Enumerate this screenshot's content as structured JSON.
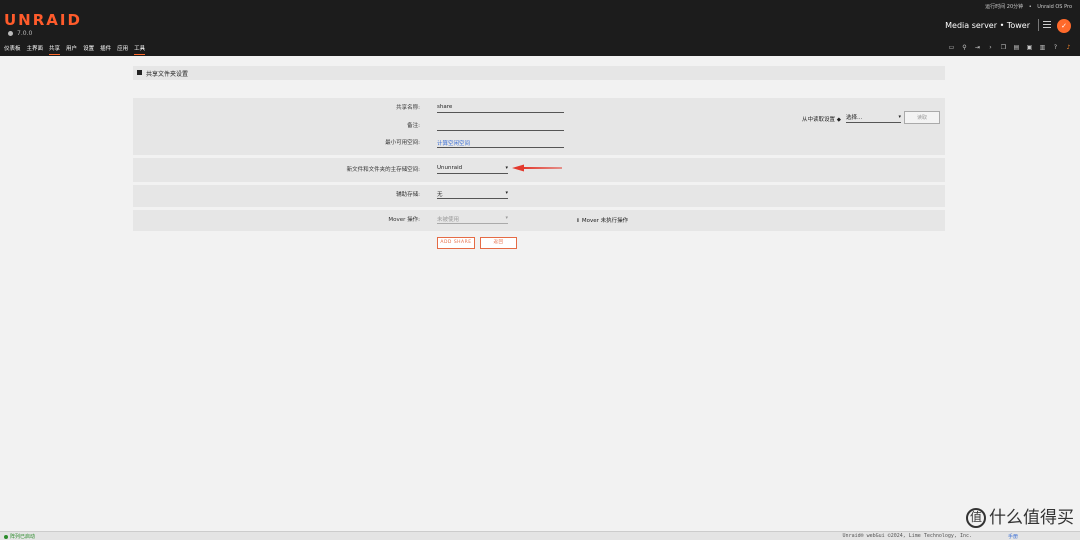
{
  "header": {
    "logo": "UNRAID",
    "version": "7.0.0",
    "uptime": "运行时间 20分钟",
    "separator": "•",
    "edition": "Unraid OS Pro",
    "server": "Media server • Tower"
  },
  "nav": {
    "items": [
      "仪表板",
      "主界面",
      "共享",
      "用户",
      "设置",
      "插件",
      "应用",
      "工具"
    ]
  },
  "panel": {
    "title": "共享文件夹设置"
  },
  "form": {
    "share_name_label": "共享名称:",
    "share_name_value": "share",
    "comment_label": "备注:",
    "comment_value": "",
    "min_free_label": "最小可用空间:",
    "min_free_value": "计算空闲空间",
    "primary_storage_label": "新文件和文件夹的主存储空间:",
    "primary_storage_value": "Ununraid",
    "secondary_storage_label": "辅助存储:",
    "secondary_storage_value": "无",
    "mover_label": "Mover 操作:",
    "mover_value": "未被使用",
    "mover_info": "Mover 未执行操作",
    "copy_from_label": "从中读取设置",
    "copy_from_value": "选择...",
    "copy_button": "读取"
  },
  "buttons": {
    "add_share": "ADD SHARE",
    "back": "返回"
  },
  "footer": {
    "status": "阵列已启动",
    "copyright": "Unraid® webGui ©2024, Lime Technology, Inc.",
    "manual": "手册"
  },
  "watermark": {
    "text": "什么值得买",
    "icon_text": "值"
  },
  "colors": {
    "accent": "#ff5b2b",
    "header_bg": "#1c1c1c",
    "arrow": "#e33a2e"
  }
}
